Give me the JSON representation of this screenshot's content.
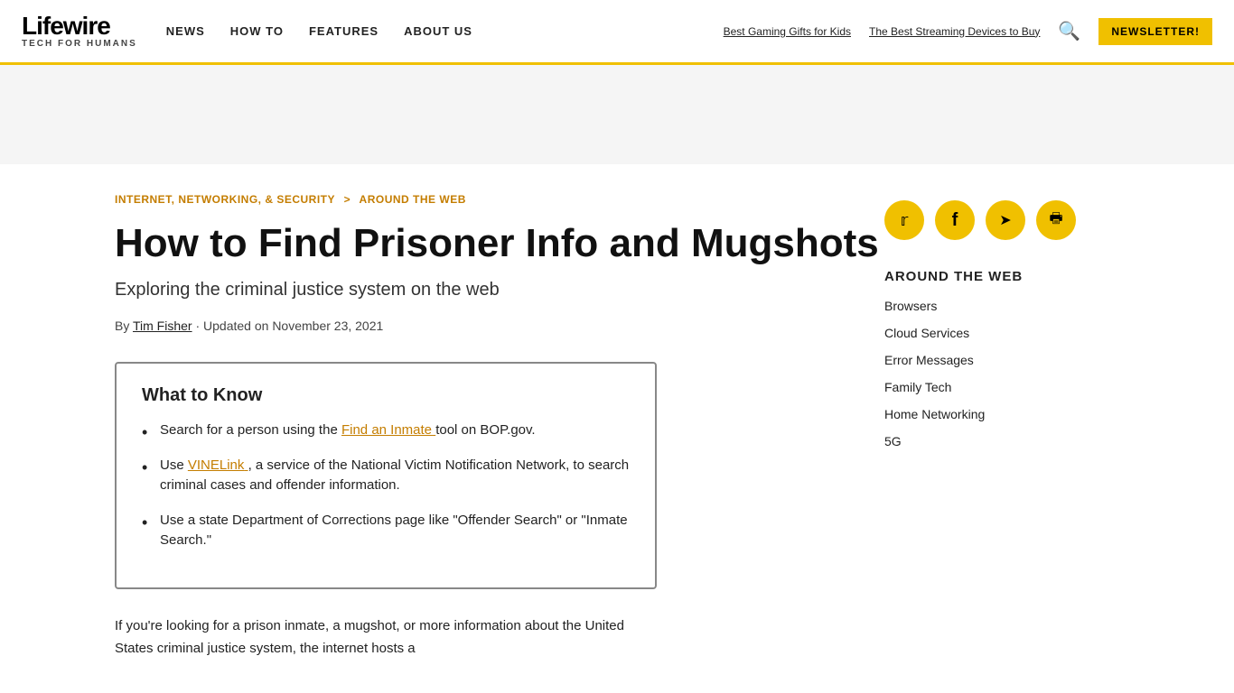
{
  "header": {
    "logo": "Lifewire",
    "tagline": "TECH FOR HUMANS",
    "nav": [
      {
        "label": "NEWS",
        "href": "#"
      },
      {
        "label": "HOW TO",
        "href": "#"
      },
      {
        "label": "FEATURES",
        "href": "#"
      },
      {
        "label": "ABOUT US",
        "href": "#"
      }
    ],
    "quick_links": [
      {
        "label": "Best Gaming Gifts for Kids",
        "href": "#"
      },
      {
        "label": "The Best Streaming Devices to Buy",
        "href": "#"
      }
    ],
    "newsletter_label": "NEWSLETTER!",
    "search_icon": "🔍"
  },
  "breadcrumb": {
    "parent": "INTERNET, NETWORKING, & SECURITY",
    "separator": ">",
    "current": "AROUND THE WEB"
  },
  "article": {
    "title": "How to Find Prisoner Info and Mugshots",
    "subtitle": "Exploring the criminal justice system on the web",
    "author_prefix": "By",
    "author": "Tim Fisher",
    "updated_prefix": "·  Updated on",
    "updated_date": "November 23, 2021"
  },
  "social": [
    {
      "icon": "🐦",
      "name": "twitter"
    },
    {
      "icon": "f",
      "name": "facebook"
    },
    {
      "icon": "✈",
      "name": "telegram"
    },
    {
      "icon": "🖨",
      "name": "print"
    }
  ],
  "sidebar": {
    "section_title": "AROUND THE WEB",
    "links": [
      {
        "label": "Browsers"
      },
      {
        "label": "Cloud Services"
      },
      {
        "label": "Error Messages"
      },
      {
        "label": "Family Tech"
      },
      {
        "label": "Home Networking"
      },
      {
        "label": "5G"
      }
    ]
  },
  "what_to_know": {
    "title": "What to Know",
    "items": [
      {
        "text_before": "Search for a person using the",
        "link_text": "Find an Inmate",
        "text_after": "tool on BOP.gov."
      },
      {
        "text_before": "Use",
        "link_text": "VINELink",
        "text_after": ", a service of the National Victim Notification Network, to search criminal cases and offender information."
      },
      {
        "text_before": "",
        "link_text": "",
        "text_after": "Use a state Department of Corrections page like \"Offender Search\" or \"Inmate Search.\""
      }
    ]
  },
  "article_body": "If you're looking for a prison inmate, a mugshot, or more information about the United States criminal justice system, the internet hosts a"
}
